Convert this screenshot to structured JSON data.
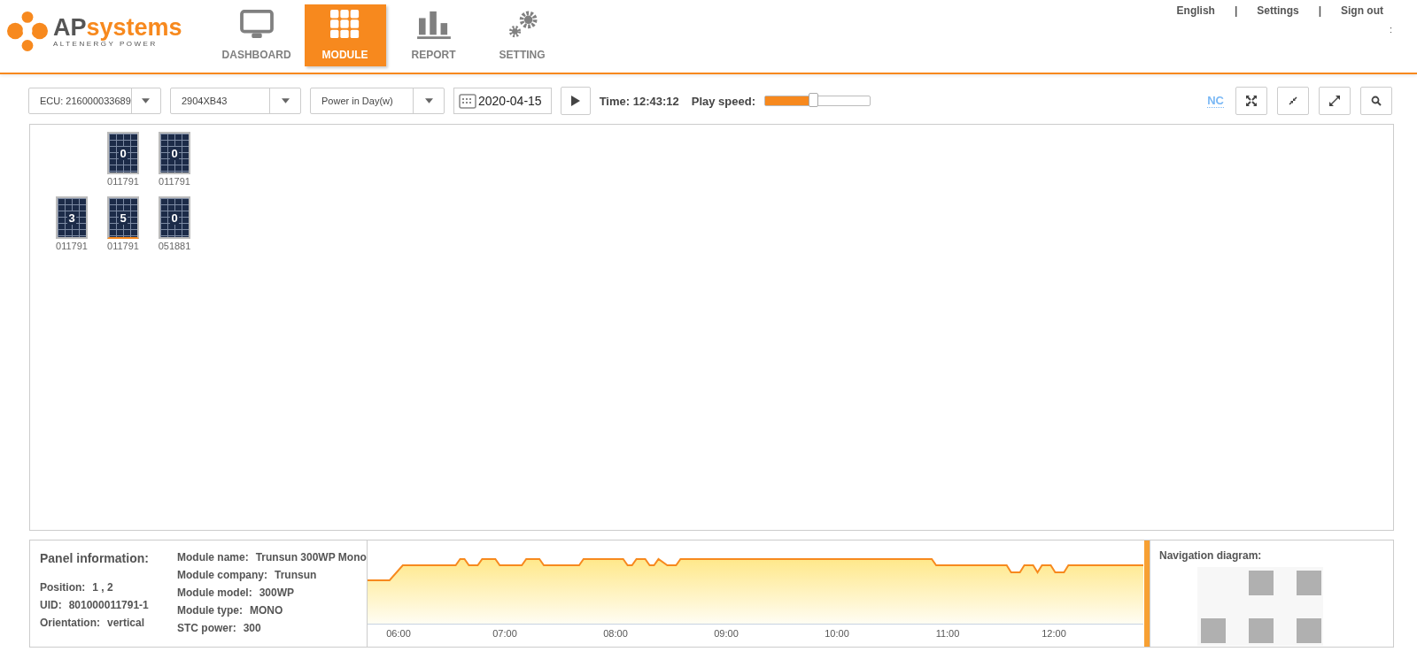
{
  "header": {
    "logo": {
      "name_prefix": "AP",
      "name_suffix": "systems",
      "tagline": "ALTENERGY POWER"
    },
    "nav": [
      {
        "label": "DASHBOARD",
        "selected": false
      },
      {
        "label": "MODULE",
        "selected": true
      },
      {
        "label": "REPORT",
        "selected": false
      },
      {
        "label": "SETTING",
        "selected": false
      }
    ],
    "top_links": [
      "English",
      "|",
      "Settings",
      "|",
      "Sign out"
    ],
    "stray_glyph": ":"
  },
  "toolbar": {
    "ecu": "ECU: 216000033689",
    "device": "2904XB43",
    "metric": "Power in Day(w)",
    "date": "2020-04-15",
    "time": "Time: 12:43:12",
    "play_speed_label": "Play speed:",
    "play_speed": {
      "level": 0.47
    },
    "nc": "NC"
  },
  "modules": [
    {
      "value": "0",
      "id": "011791",
      "selected": false
    },
    {
      "value": "0",
      "id": "011791",
      "selected": false
    },
    {
      "value": "3",
      "id": "011791",
      "selected": false
    },
    {
      "value": "5",
      "id": "011791",
      "selected": true
    },
    {
      "value": "0",
      "id": "051881",
      "selected": false
    }
  ],
  "panel_info": {
    "title": "Panel information:",
    "left": [
      {
        "label": "Position:",
        "value": "1 , 2"
      },
      {
        "label": "UID:",
        "value": "801000011791-1"
      },
      {
        "label": "Orientation:",
        "value": "vertical"
      }
    ],
    "right": [
      {
        "label": "Module name:",
        "value": "Trunsun 300WP Mono"
      },
      {
        "label": "Module company:",
        "value": "Trunsun"
      },
      {
        "label": "Module model:",
        "value": "300WP"
      },
      {
        "label": "Module type:",
        "value": "MONO"
      },
      {
        "label": "STC power:",
        "value": "300"
      }
    ]
  },
  "power_chart": {
    "time_labels": [
      "06:00",
      "07:00",
      "08:00",
      "09:00",
      "10:00",
      "11:00",
      "12:00"
    ]
  },
  "navigation": {
    "title": "Navigation diagram:"
  }
}
